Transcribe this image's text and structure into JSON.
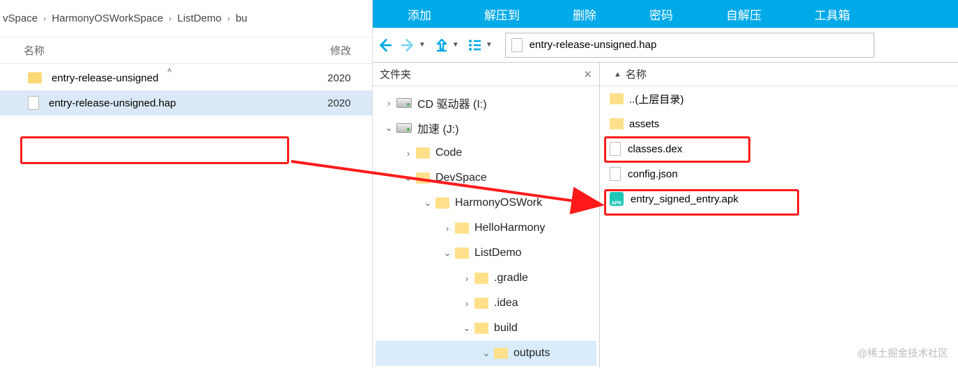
{
  "explorer": {
    "breadcrumb": [
      "vSpace",
      "HarmonyOSWorkSpace",
      "ListDemo",
      "bu"
    ],
    "col_name": "名称",
    "col_modified": "修改",
    "rows": [
      {
        "name": "entry-release-unsigned",
        "date": "2020"
      },
      {
        "name": "entry-release-unsigned.hap",
        "date": "2020"
      }
    ]
  },
  "archive": {
    "ribbon": [
      "添加",
      "解压到",
      "删除",
      "密码",
      "自解压",
      "工具箱"
    ],
    "address_file": "entry-release-unsigned.hap",
    "tree_header": "文件夹",
    "list_header": "名称",
    "tree": {
      "drive_i": "CD 驱动器 (I:)",
      "drive_j": "加速 (J:)",
      "code": "Code",
      "devspace": "DevSpace",
      "harmonywork": "HarmonyOSWork",
      "helloharmony": "HelloHarmony",
      "listdemo": "ListDemo",
      "gradle": ".gradle",
      "idea": ".idea",
      "build": "build",
      "outputs": "outputs"
    },
    "files": {
      "parent": "..(上层目录)",
      "assets": "assets",
      "classes": "classes.dex",
      "config": "config.json",
      "apk": "entry_signed_entry.apk"
    }
  },
  "watermark": "@稀土掘金技术社区"
}
